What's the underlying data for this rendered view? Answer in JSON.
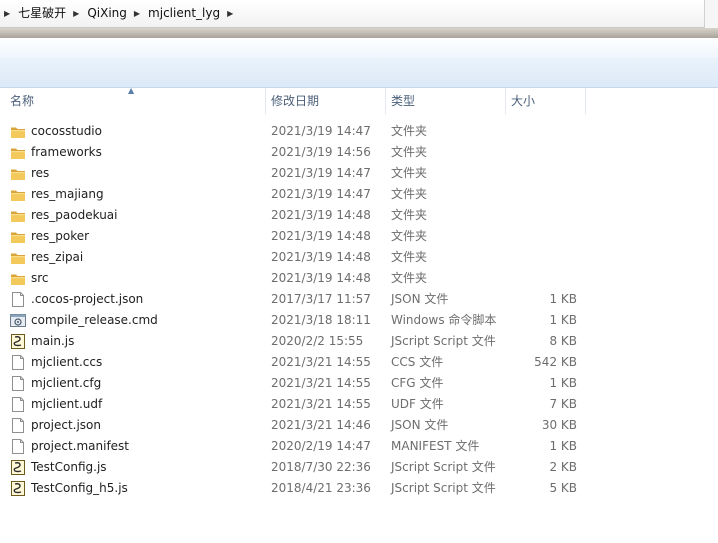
{
  "breadcrumb": {
    "items": [
      "七星破开",
      "QiXing",
      "mjclient_lyg"
    ]
  },
  "columns": {
    "name": "名称",
    "modified": "修改日期",
    "type": "类型",
    "size": "大小"
  },
  "files": [
    {
      "name": "cocosstudio",
      "modified": "2021/3/19 14:47",
      "type": "文件夹",
      "size": "",
      "icon": "folder-icon"
    },
    {
      "name": "frameworks",
      "modified": "2021/3/19 14:56",
      "type": "文件夹",
      "size": "",
      "icon": "folder-icon"
    },
    {
      "name": "res",
      "modified": "2021/3/19 14:47",
      "type": "文件夹",
      "size": "",
      "icon": "folder-icon"
    },
    {
      "name": "res_majiang",
      "modified": "2021/3/19 14:47",
      "type": "文件夹",
      "size": "",
      "icon": "folder-icon"
    },
    {
      "name": "res_paodekuai",
      "modified": "2021/3/19 14:48",
      "type": "文件夹",
      "size": "",
      "icon": "folder-icon"
    },
    {
      "name": "res_poker",
      "modified": "2021/3/19 14:48",
      "type": "文件夹",
      "size": "",
      "icon": "folder-icon"
    },
    {
      "name": "res_zipai",
      "modified": "2021/3/19 14:48",
      "type": "文件夹",
      "size": "",
      "icon": "folder-icon"
    },
    {
      "name": "src",
      "modified": "2021/3/19 14:48",
      "type": "文件夹",
      "size": "",
      "icon": "folder-icon"
    },
    {
      "name": ".cocos-project.json",
      "modified": "2017/3/17 11:57",
      "type": "JSON 文件",
      "size": "1 KB",
      "icon": "file-icon"
    },
    {
      "name": "compile_release.cmd",
      "modified": "2021/3/18 18:11",
      "type": "Windows 命令脚本",
      "size": "1 KB",
      "icon": "cmd-script-icon"
    },
    {
      "name": "main.js",
      "modified": "2020/2/2 15:55",
      "type": "JScript Script 文件",
      "size": "8 KB",
      "icon": "jscript-icon"
    },
    {
      "name": "mjclient.ccs",
      "modified": "2021/3/21 14:55",
      "type": "CCS 文件",
      "size": "542 KB",
      "icon": "file-icon"
    },
    {
      "name": "mjclient.cfg",
      "modified": "2021/3/21 14:55",
      "type": "CFG 文件",
      "size": "1 KB",
      "icon": "file-icon"
    },
    {
      "name": "mjclient.udf",
      "modified": "2021/3/21 14:55",
      "type": "UDF 文件",
      "size": "7 KB",
      "icon": "file-icon"
    },
    {
      "name": "project.json",
      "modified": "2021/3/21 14:46",
      "type": "JSON 文件",
      "size": "30 KB",
      "icon": "file-icon"
    },
    {
      "name": "project.manifest",
      "modified": "2020/2/19 14:47",
      "type": "MANIFEST 文件",
      "size": "1 KB",
      "icon": "file-icon"
    },
    {
      "name": "TestConfig.js",
      "modified": "2018/7/30 22:36",
      "type": "JScript Script 文件",
      "size": "2 KB",
      "icon": "jscript-icon"
    },
    {
      "name": "TestConfig_h5.js",
      "modified": "2018/4/21 23:36",
      "type": "JScript Script 文件",
      "size": "5 KB",
      "icon": "jscript-icon"
    }
  ],
  "colors": {
    "folder": "#e8b84a",
    "header_text": "#4c607a",
    "detail_text": "#6d6d6d"
  }
}
